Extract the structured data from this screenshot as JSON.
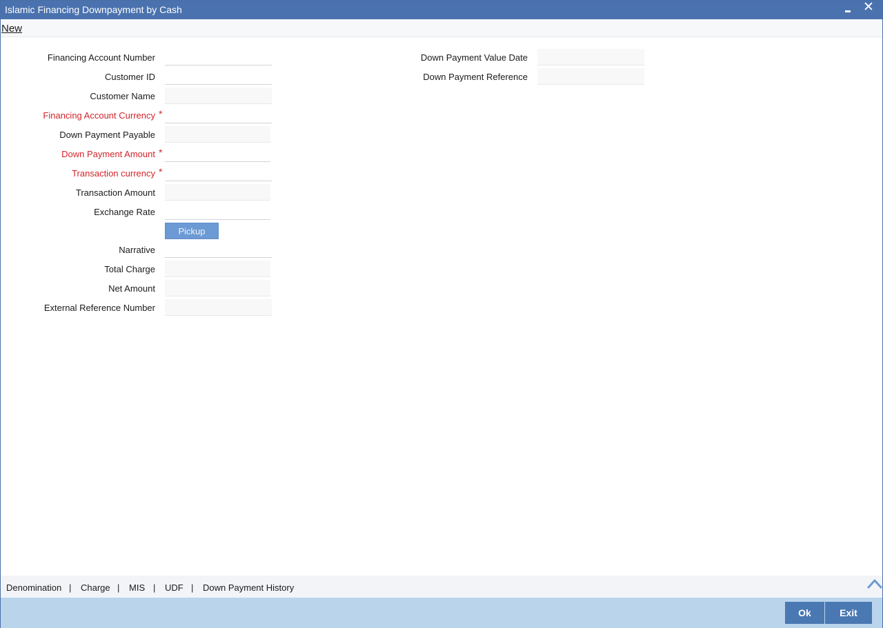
{
  "window": {
    "title": "Islamic Financing Downpayment by Cash",
    "minimize_icon": "minimize-icon",
    "close_icon": "close-icon",
    "close_glyph": "✕"
  },
  "toolbar": {
    "new_label": "New"
  },
  "form": {
    "financing_account_number": {
      "label": "Financing Account Number",
      "value": ""
    },
    "customer_id": {
      "label": "Customer ID",
      "value": ""
    },
    "customer_name": {
      "label": "Customer Name",
      "value": ""
    },
    "financing_account_currency": {
      "label": "Financing Account Currency",
      "required": "*",
      "value": ""
    },
    "down_payment_payable": {
      "label": "Down Payment Payable",
      "value": ""
    },
    "down_payment_amount": {
      "label": "Down Payment Amount",
      "required": "*",
      "value": ""
    },
    "transaction_currency": {
      "label": "Transaction currency",
      "required": "*",
      "value": ""
    },
    "transaction_amount": {
      "label": "Transaction Amount",
      "value": ""
    },
    "exchange_rate": {
      "label": "Exchange Rate",
      "value": ""
    },
    "pickup_label": "Pickup",
    "narrative": {
      "label": "Narrative",
      "value": ""
    },
    "total_charge": {
      "label": "Total Charge",
      "value": ""
    },
    "net_amount": {
      "label": "Net Amount",
      "value": ""
    },
    "external_reference_number": {
      "label": "External Reference Number",
      "value": ""
    },
    "down_payment_value_date": {
      "label": "Down Payment Value Date",
      "value": ""
    },
    "down_payment_reference": {
      "label": "Down Payment Reference",
      "value": ""
    }
  },
  "subsystems": {
    "items": [
      "Denomination",
      "Charge",
      "MIS",
      "UDF",
      "Down Payment History"
    ],
    "separator": "|",
    "scroll_icon": "chevron-up-icon"
  },
  "footer": {
    "ok_label": "Ok",
    "exit_label": "Exit"
  },
  "colors": {
    "titlebar": "#4a72ae",
    "required": "#d2232a",
    "footer": "#bad4ec",
    "button": "#4a78b2"
  }
}
